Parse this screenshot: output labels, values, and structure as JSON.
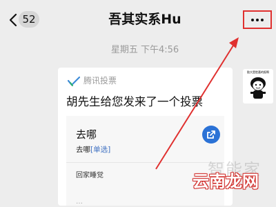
{
  "header": {
    "unread_count": "52",
    "title": "吾其实系Hu"
  },
  "message": {
    "timestamp": "星期五 下午4:56",
    "card": {
      "app_name": "腾讯投票",
      "text": "胡先生给您发来了一个投票",
      "poll": {
        "title": "去哪",
        "subtitle": "去哪",
        "type_tag": "[单选]",
        "options": [
          "回家睡觉",
          "…"
        ]
      }
    },
    "sticker": {
      "caption": "胎大是脸喜的报啊"
    }
  },
  "watermark": {
    "faint": "智能家",
    "brand": "云南龙网"
  },
  "colors": {
    "highlight": "#e0302f",
    "link": "#3d6fc1",
    "share": "#2b72d6"
  }
}
